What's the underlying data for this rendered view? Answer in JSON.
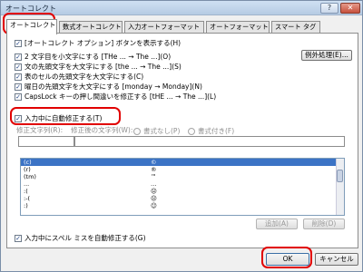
{
  "window": {
    "title": "オートコレクト",
    "help_label": "?",
    "close_label": "✕"
  },
  "tabs": [
    {
      "label": "オートコレクト",
      "active": true
    },
    {
      "label": "数式オートコレクト",
      "active": false
    },
    {
      "label": "入力オートフォーマット",
      "active": false
    },
    {
      "label": "オートフォーマット",
      "active": false
    },
    {
      "label": "スマート タグ",
      "active": false
    }
  ],
  "options": {
    "show_buttons": "[オートコレクト オプション] ボタンを表示する(H)",
    "two_initials": "2 文字目を小文字にする [THe ... → The ...](O)",
    "first_letter_sentence": "文の先頭文字を大文字にする [the ... → The ...](S)",
    "first_letter_cell": "表のセルの先頭文字を大文字にする(C)",
    "capitalize_days": "曜日の先頭文字を大文字にする [monday → Monday](N)",
    "capslock": "CapsLock キーの押し間違いを修正する [tHE ... → The ...](L)",
    "replace_as_you_type": "入力中に自動修正する(T)",
    "spelling": "入力中にスペル ミスを自動修正する(G)"
  },
  "exceptions_button": "例外処理(E)...",
  "replace_label": "修正文字列(R):",
  "with_label": "修正後の文字列(W):",
  "radio_plain": "書式なし(P)",
  "radio_formatted": "書式付き(F)",
  "replace_table": [
    {
      "from": "(c)",
      "to": "©"
    },
    {
      "from": "(r)",
      "to": "®"
    },
    {
      "from": "(tm)",
      "to": "™"
    },
    {
      "from": "...",
      "to": "…"
    },
    {
      "from": ":(",
      "to": "☹"
    },
    {
      "from": ":-(",
      "to": "☹"
    },
    {
      "from": ":)",
      "to": "☺"
    }
  ],
  "add_button": "追加(A)",
  "delete_button": "削除(D)",
  "ok_button": "OK",
  "cancel_button": "キャンセル"
}
